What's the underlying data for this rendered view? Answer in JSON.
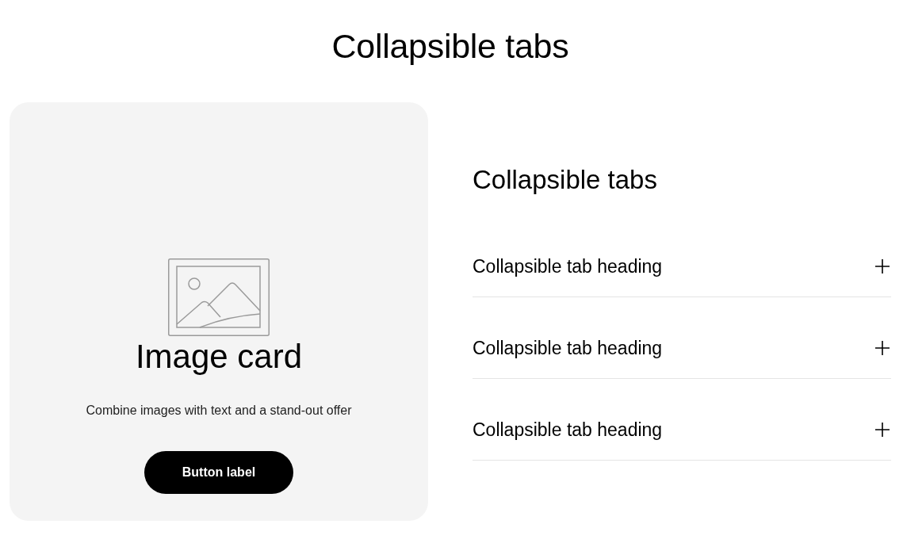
{
  "page_title": "Collapsible tabs",
  "image_card": {
    "heading": "Image card",
    "text": "Combine images with text and a stand-out offer",
    "button": "Button label"
  },
  "collapsible_tabs": {
    "heading": "Collapsible tabs",
    "items": [
      {
        "heading": "Collapsible tab heading",
        "expanded": false
      },
      {
        "heading": "Collapsible tab heading",
        "expanded": false
      },
      {
        "heading": "Collapsible tab heading",
        "expanded": false
      }
    ]
  }
}
